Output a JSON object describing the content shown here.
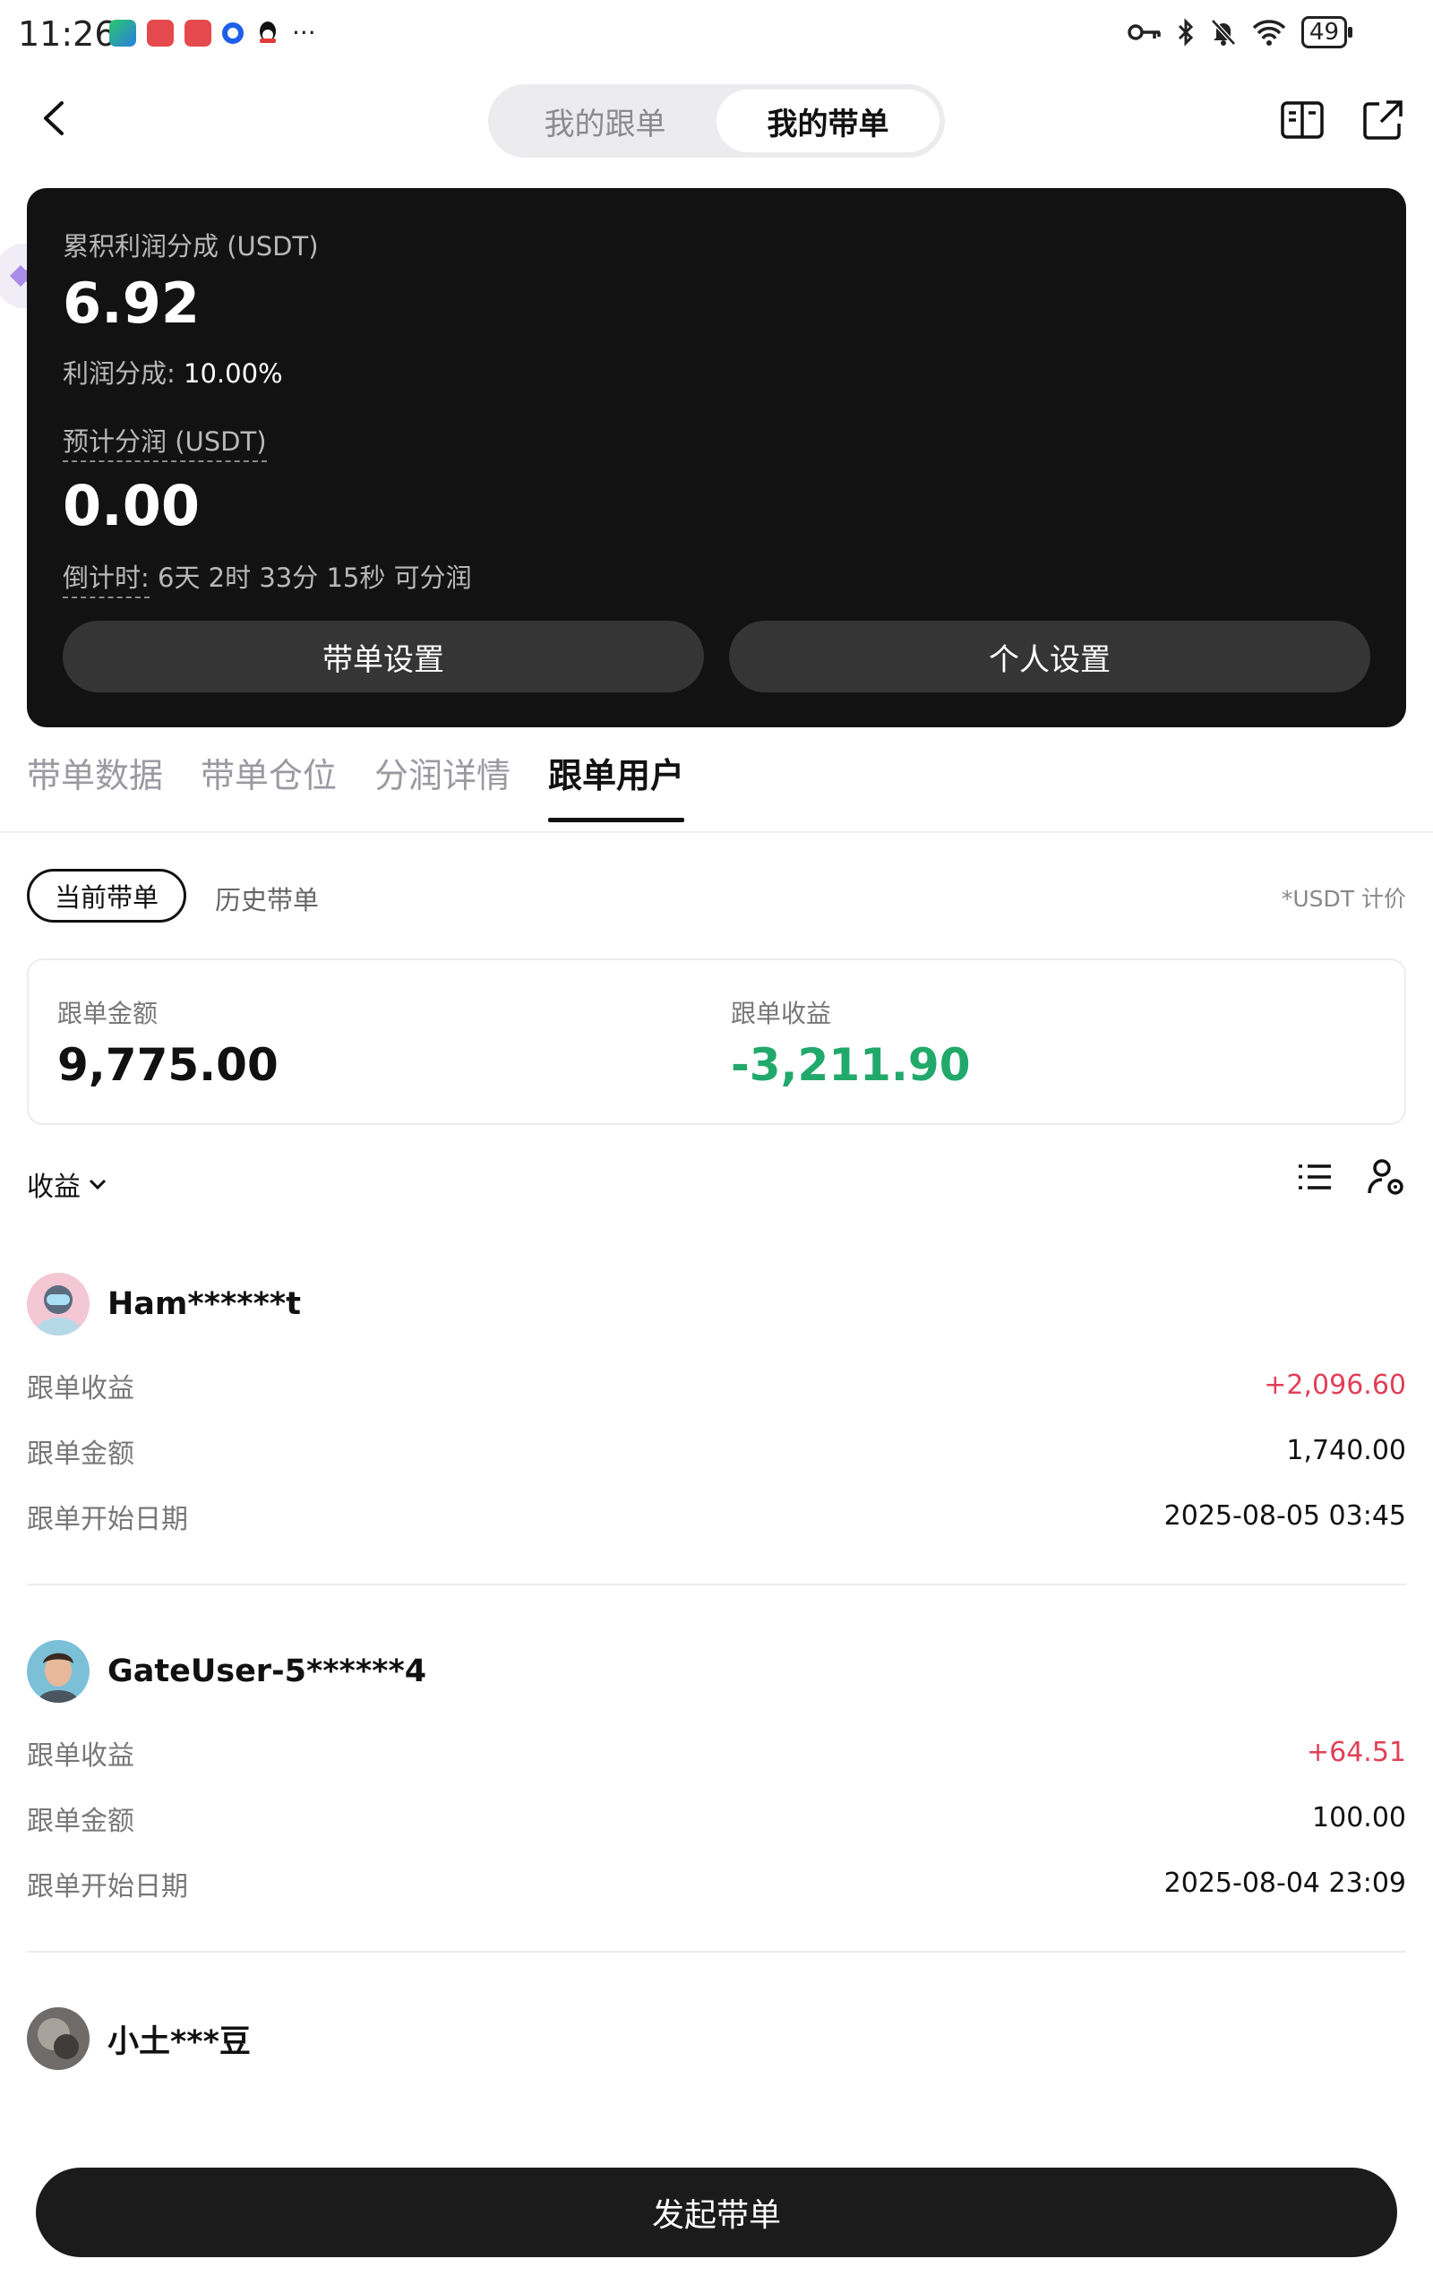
{
  "status_bar": {
    "time": "11:26",
    "battery": "49",
    "more": "···"
  },
  "header": {
    "segments": [
      "我的跟单",
      "我的带单"
    ],
    "active_segment": 1
  },
  "card": {
    "cumulative_label": "累积利润分成 (USDT)",
    "cumulative_value": "6.92",
    "share_rate_label": "利润分成:",
    "share_rate_value": "10.00%",
    "expected_label": "预计分润 (USDT)",
    "expected_value": "0.00",
    "countdown_label": "倒计时:",
    "countdown_value": "6天 2时 33分 15秒 可分润",
    "btn_lead_settings": "带单设置",
    "btn_personal_settings": "个人设置"
  },
  "tabs": [
    {
      "label": "带单数据"
    },
    {
      "label": "带单仓位"
    },
    {
      "label": "分润详情"
    },
    {
      "label": "跟单用户"
    }
  ],
  "filter": {
    "current": "当前带单",
    "history": "历史带单",
    "unit_note": "*USDT 计价"
  },
  "summary": {
    "amount_label": "跟单金额",
    "amount_value": "9,775.00",
    "profit_label": "跟单收益",
    "profit_value": "-3,211.90"
  },
  "sort": {
    "label": "收益"
  },
  "followers": [
    {
      "name": "Ham******t",
      "profit_label": "跟单收益",
      "profit": "+2,096.60",
      "amount_label": "跟单金额",
      "amount": "1,740.00",
      "date_label": "跟单开始日期",
      "date": "2025-08-05 03:45"
    },
    {
      "name": "GateUser-5******4",
      "profit_label": "跟单收益",
      "profit": "+64.51",
      "amount_label": "跟单金额",
      "amount": "100.00",
      "date_label": "跟单开始日期",
      "date": "2025-08-04 23:09"
    },
    {
      "name": "小土***豆"
    }
  ],
  "bottom": {
    "start_lead_label": "发起带单"
  },
  "colors": {
    "positive": "#e04058",
    "negative": "#21a96b",
    "card_bg": "#121212"
  }
}
